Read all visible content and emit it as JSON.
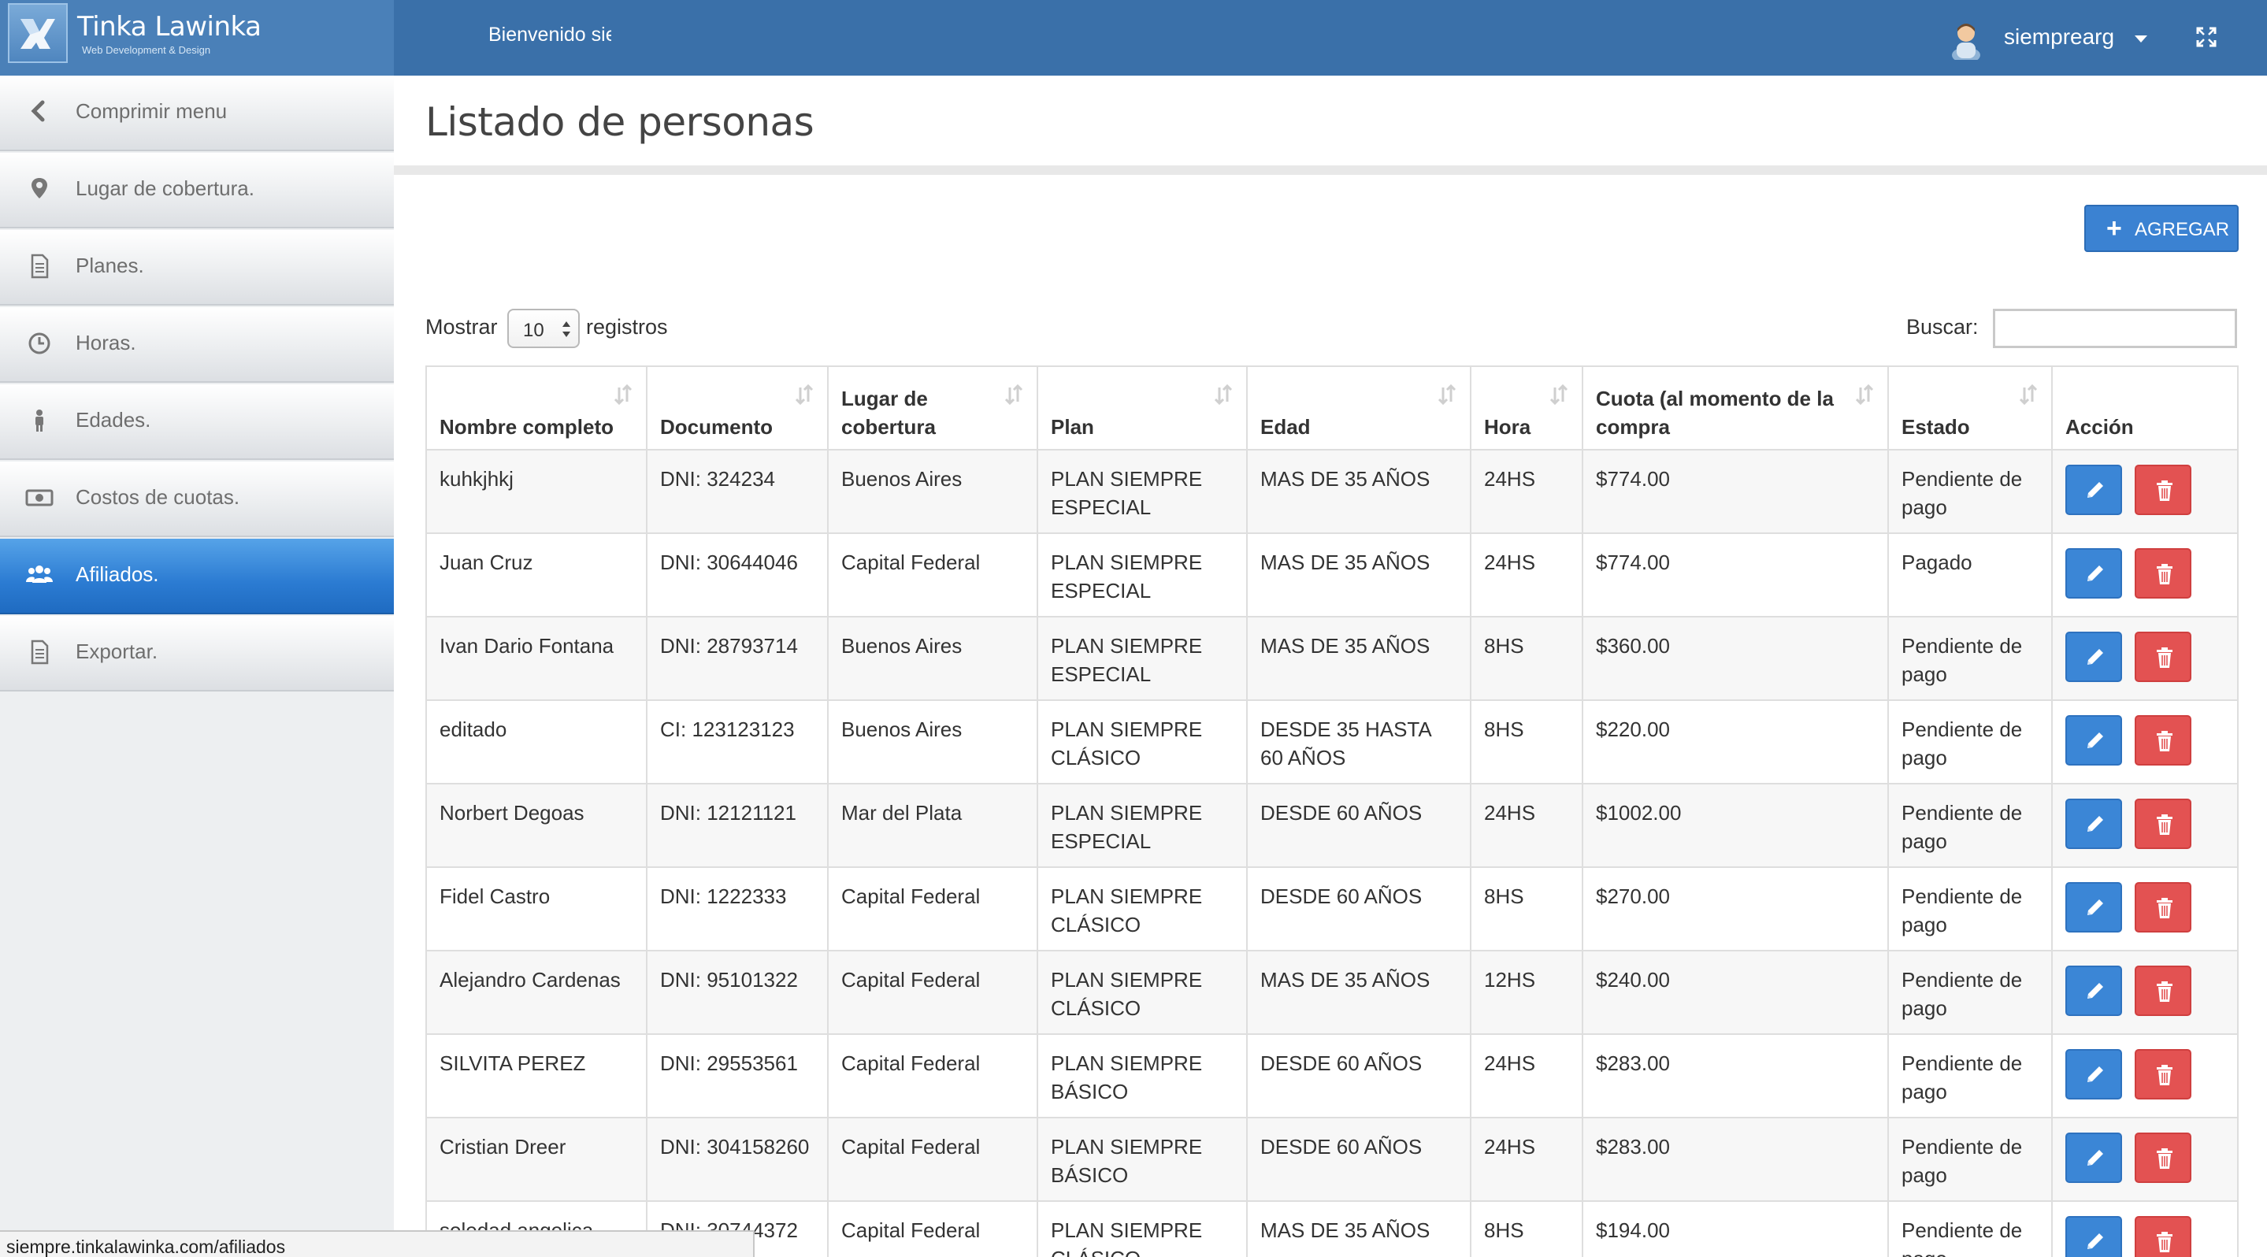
{
  "brand": {
    "name": "Tinka Lawinka",
    "tagline": "Web Development & Design"
  },
  "header": {
    "welcome": "Bienvenido siempre",
    "username": "siemprearg"
  },
  "sidebar": {
    "items": [
      {
        "label": "Comprimir menu",
        "icon": "chevron-left-icon"
      },
      {
        "label": "Lugar de cobertura.",
        "icon": "map-marker-icon"
      },
      {
        "label": "Planes.",
        "icon": "document-icon"
      },
      {
        "label": "Horas.",
        "icon": "clock-icon"
      },
      {
        "label": "Edades.",
        "icon": "person-icon"
      },
      {
        "label": "Costos de cuotas.",
        "icon": "money-icon"
      },
      {
        "label": "Afiliados.",
        "icon": "users-icon",
        "active": true
      },
      {
        "label": "Exportar.",
        "icon": "document-icon"
      }
    ]
  },
  "main": {
    "title": "Listado de personas",
    "add_label": "AGREGAR",
    "length_before": "Mostrar",
    "length_value": "10",
    "length_after": "registros",
    "search_label": "Buscar:",
    "search_value": ""
  },
  "table": {
    "columns": [
      "Nombre completo",
      "Documento",
      "Lugar de cobertura",
      "Plan",
      "Edad",
      "Hora",
      "Cuota (al momento de la compra",
      "Estado",
      "Acción"
    ],
    "rows": [
      [
        "kuhkjhkj",
        "DNI: 324234",
        "Buenos Aires",
        "PLAN SIEMPRE ESPECIAL",
        "MAS DE 35 AÑOS",
        "24HS",
        "$774.00",
        "Pendiente de pago"
      ],
      [
        "Juan Cruz",
        "DNI: 30644046",
        "Capital Federal",
        "PLAN SIEMPRE ESPECIAL",
        "MAS DE 35 AÑOS",
        "24HS",
        "$774.00",
        "Pagado"
      ],
      [
        "Ivan Dario Fontana",
        "DNI: 28793714",
        "Buenos Aires",
        "PLAN SIEMPRE ESPECIAL",
        "MAS DE 35 AÑOS",
        "8HS",
        "$360.00",
        "Pendiente de pago"
      ],
      [
        "editado",
        "CI: 123123123",
        "Buenos Aires",
        "PLAN SIEMPRE CLÁSICO",
        "DESDE 35 HASTA 60 AÑOS",
        "8HS",
        "$220.00",
        "Pendiente de pago"
      ],
      [
        "Norbert Degoas",
        "DNI: 12121121",
        "Mar del Plata",
        "PLAN SIEMPRE ESPECIAL",
        "DESDE 60 AÑOS",
        "24HS",
        "$1002.00",
        "Pendiente de pago"
      ],
      [
        "Fidel Castro",
        "DNI: 1222333",
        "Capital Federal",
        "PLAN SIEMPRE CLÁSICO",
        "DESDE 60 AÑOS",
        "8HS",
        "$270.00",
        "Pendiente de pago"
      ],
      [
        "Alejandro Cardenas",
        "DNI: 95101322",
        "Capital Federal",
        "PLAN SIEMPRE CLÁSICO",
        "MAS DE 35 AÑOS",
        "12HS",
        "$240.00",
        "Pendiente de pago"
      ],
      [
        "SILVITA PEREZ",
        "DNI: 29553561",
        "Capital Federal",
        "PLAN SIEMPRE BÁSICO",
        "DESDE 60 AÑOS",
        "24HS",
        "$283.00",
        "Pendiente de pago"
      ],
      [
        "Cristian Dreer",
        "DNI: 304158260",
        "Capital Federal",
        "PLAN SIEMPRE BÁSICO",
        "DESDE 60 AÑOS",
        "24HS",
        "$283.00",
        "Pendiente de pago"
      ],
      [
        "soledad angelica",
        "DNI: 30744372",
        "Capital Federal",
        "PLAN SIEMPRE CLÁSICO",
        "MAS DE 35 AÑOS",
        "8HS",
        "$194.00",
        "Pendiente de pago"
      ]
    ]
  },
  "status_bar": {
    "url": "siempre.tinkalawinka.com/afiliados"
  },
  "colors": {
    "topbar": "#3a70a9",
    "sidebar_active": "#2b7bd2",
    "edit_button": "#3b86d6",
    "delete_button": "#e35252",
    "add_button": "#3b82d2"
  }
}
